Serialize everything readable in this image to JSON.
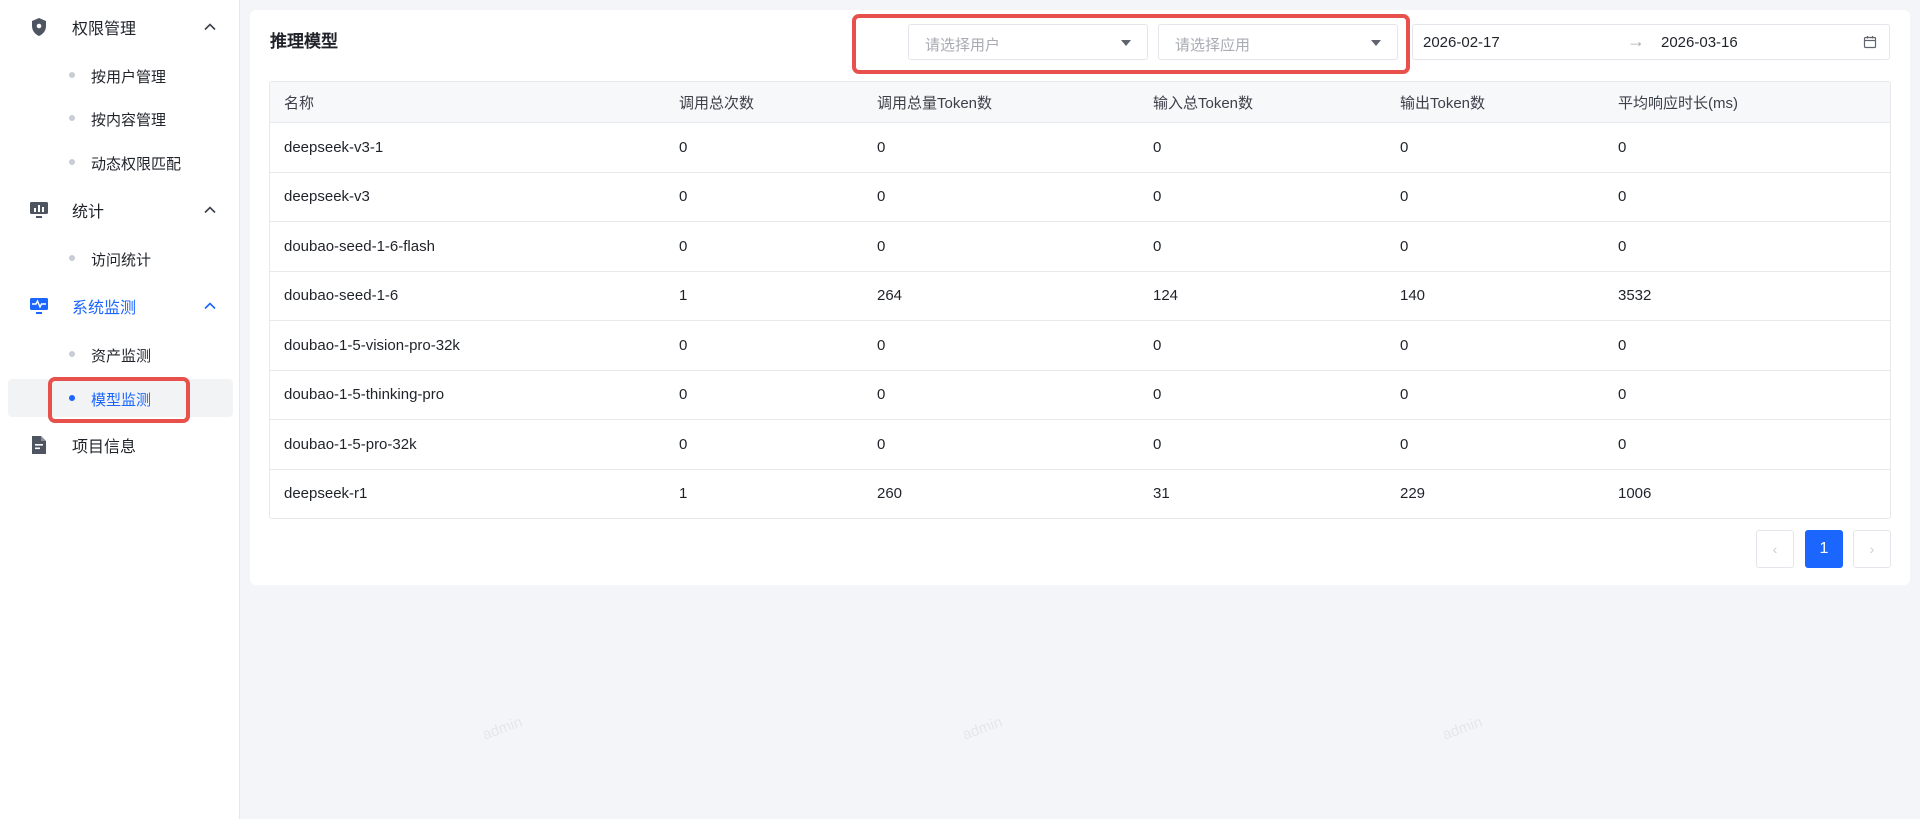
{
  "sidebar": {
    "groups": [
      {
        "label": "权限管理",
        "icon": "shield-icon"
      },
      {
        "label": "统计",
        "icon": "monitor-chart-icon"
      },
      {
        "label": "系统监测",
        "icon": "monitor-pulse-icon"
      },
      {
        "label": "项目信息",
        "icon": "document-icon"
      }
    ],
    "items": [
      {
        "label": "按用户管理"
      },
      {
        "label": "按内容管理"
      },
      {
        "label": "动态权限匹配"
      },
      {
        "label": "访问统计"
      },
      {
        "label": "资产监测"
      },
      {
        "label": "模型监测"
      }
    ]
  },
  "main": {
    "title": "推理模型",
    "filters": {
      "user_placeholder": "请选择用户",
      "app_placeholder": "请选择应用",
      "date_start": "2026-02-17",
      "date_arrow": "→",
      "date_end": "2026-03-16"
    },
    "table": {
      "columns": [
        "名称",
        "调用总次数",
        "调用总量Token数",
        "输入总Token数",
        "输出Token数",
        "平均响应时长(ms)"
      ],
      "rows": [
        [
          "deepseek-v3-1",
          "0",
          "0",
          "0",
          "0",
          "0"
        ],
        [
          "deepseek-v3",
          "0",
          "0",
          "0",
          "0",
          "0"
        ],
        [
          "doubao-seed-1-6-flash",
          "0",
          "0",
          "0",
          "0",
          "0"
        ],
        [
          "doubao-seed-1-6",
          "1",
          "264",
          "124",
          "140",
          "3532"
        ],
        [
          "doubao-1-5-vision-pro-32k",
          "0",
          "0",
          "0",
          "0",
          "0"
        ],
        [
          "doubao-1-5-thinking-pro",
          "0",
          "0",
          "0",
          "0",
          "0"
        ],
        [
          "doubao-1-5-pro-32k",
          "0",
          "0",
          "0",
          "0",
          "0"
        ],
        [
          "deepseek-r1",
          "1",
          "260",
          "31",
          "229",
          "1006"
        ]
      ]
    },
    "pagination": {
      "prev": "‹",
      "current": "1",
      "next": "›"
    }
  },
  "watermark_text": "admin",
  "colors": {
    "accent": "#1a66ff",
    "highlight": "#e8504b"
  }
}
